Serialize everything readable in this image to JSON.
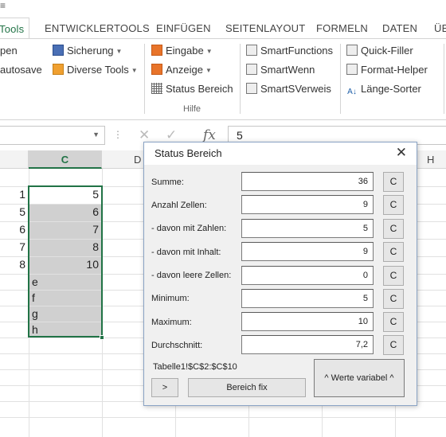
{
  "ribbon": {
    "tabs": [
      {
        "id": "tools",
        "label": "Tools",
        "active": true
      },
      {
        "id": "entwicklertools",
        "label": "ENTWICKLERTOOLS"
      },
      {
        "id": "einfuegen",
        "label": "EINFÜGEN"
      },
      {
        "id": "seitenlayout",
        "label": "SEITENLAYOUT"
      },
      {
        "id": "formeln",
        "label": "FORMELN"
      },
      {
        "id": "daten",
        "label": "DATEN"
      },
      {
        "id": "ueb",
        "label": "ÜE"
      }
    ],
    "items": {
      "open": "pen",
      "autosave": "autosave",
      "sicherung": "Sicherung",
      "diverse_tools": "Diverse Tools",
      "eingabe": "Eingabe",
      "anzeige": "Anzeige",
      "status_bereich": "Status Bereich",
      "smart_functions": "SmartFunctions",
      "smart_wenn": "SmartWenn",
      "smart_sverweis": "SmartSVerweis",
      "quick_filler": "Quick-Filler",
      "format_helper": "Format-Helper",
      "laenge_sorter": "Länge-Sorter"
    },
    "group_label": "Hilfe"
  },
  "formula_bar": {
    "value": "5",
    "fx": "fx"
  },
  "sheet": {
    "columns": [
      {
        "id": "b",
        "label": ""
      },
      {
        "id": "c",
        "label": "C",
        "active": true
      },
      {
        "id": "d",
        "label": "D"
      },
      {
        "id": "h",
        "label": "H"
      }
    ],
    "column_b_values": [
      "1",
      "5",
      "6",
      "7",
      "8"
    ],
    "column_c_values": [
      "5",
      "6",
      "7",
      "8",
      "10",
      "e",
      "f",
      "g",
      "h"
    ]
  },
  "dialog": {
    "title": "Status Bereich",
    "rows": [
      {
        "label": "Summe:",
        "value": "36"
      },
      {
        "label": "Anzahl Zellen:",
        "value": "9"
      },
      {
        "label": "- davon mit Zahlen:",
        "value": "5"
      },
      {
        "label": "- davon mit Inhalt:",
        "value": "9"
      },
      {
        "label": "- davon leere Zellen:",
        "value": "0"
      },
      {
        "label": "Minimum:",
        "value": "5"
      },
      {
        "label": "Maximum:",
        "value": "10"
      },
      {
        "label": "Durchschnitt:",
        "value": "7,2"
      }
    ],
    "copy_button_label": "C",
    "range": "Tabelle1!$C$2:$C$10",
    "buttons": {
      "next": ">",
      "bereich_fix": "Bereich fix",
      "werte_variabel": "^ Werte variabel ^"
    }
  }
}
